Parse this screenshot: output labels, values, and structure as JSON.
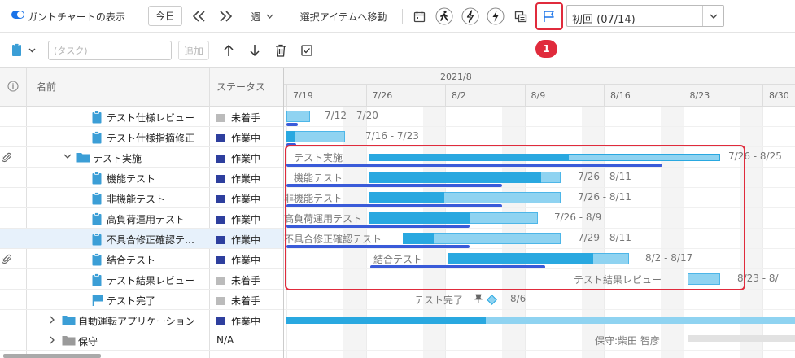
{
  "toolbar": {
    "gantt_toggle_label": "ガントチャートの表示",
    "today_label": "今日",
    "scale_label": "週",
    "move_to_selected_label": "選択アイテムへ移動",
    "milestone_select_value": "初回 (07/14)",
    "callout_number": "1"
  },
  "toolbar2": {
    "task_placeholder": "(タスク)",
    "add_label": "追加"
  },
  "grid": {
    "columns": {
      "name": "名前",
      "status": "ステータス"
    },
    "rows": [
      {
        "name": "テスト仕様レビュー",
        "status": "未着手",
        "status_color": "#bbbbbb",
        "icon": "clipboard-icon"
      },
      {
        "name": "テスト仕様指摘修正",
        "status": "作業中",
        "status_color": "#2e3f9e",
        "icon": "clipboard-icon"
      },
      {
        "name": "テスト実施",
        "status": "作業中",
        "status_color": "#2e3f9e",
        "icon": "folder-icon"
      },
      {
        "name": "機能テスト",
        "status": "作業中",
        "status_color": "#2e3f9e",
        "icon": "clipboard-icon"
      },
      {
        "name": "非機能テスト",
        "status": "作業中",
        "status_color": "#2e3f9e",
        "icon": "clipboard-icon"
      },
      {
        "name": "高負荷運用テスト",
        "status": "作業中",
        "status_color": "#2e3f9e",
        "icon": "clipboard-icon"
      },
      {
        "name": "不具合修正確認テ…",
        "status": "作業中",
        "status_color": "#2e3f9e",
        "icon": "clipboard-icon"
      },
      {
        "name": "結合テスト",
        "status": "作業中",
        "status_color": "#2e3f9e",
        "icon": "clipboard-icon"
      },
      {
        "name": "テスト結果レビュー",
        "status": "未着手",
        "status_color": "#bbbbbb",
        "icon": "clipboard-icon"
      },
      {
        "name": "テスト完了",
        "status": "未着手",
        "status_color": "#bbbbbb",
        "icon": "flag-icon"
      },
      {
        "name": "自動運転アプリケーション",
        "status": "作業中",
        "status_color": "#2e3f9e",
        "icon": "folder-icon"
      },
      {
        "name": "保守",
        "status": "N/A",
        "status_color": "",
        "icon": "folder-icon"
      }
    ]
  },
  "gantt": {
    "month": "2021/8",
    "weeks": [
      "7/19",
      "7/26",
      "8/2",
      "8/9",
      "8/16",
      "8/23",
      "8/30"
    ],
    "items": [
      {
        "label": "",
        "dates": "7/12 - 7/20"
      },
      {
        "label": "",
        "dates": "7/16 - 7/23"
      },
      {
        "label": "テスト実施",
        "dates": "7/26 - 8/25"
      },
      {
        "label": "機能テスト",
        "dates": "7/26 - 8/11"
      },
      {
        "label": "非機能テスト",
        "dates": "7/26 - 8/11"
      },
      {
        "label": "高負荷運用テスト",
        "dates": "7/26 - 8/9"
      },
      {
        "label": "不具合修正確認テスト",
        "dates": "7/29 - 8/11"
      },
      {
        "label": "結合テスト",
        "dates": "8/2 - 8/17"
      },
      {
        "label": "テスト結果レビュー",
        "dates": "8/23 - 8/"
      },
      {
        "label": "テスト完了",
        "dates": "8/6"
      },
      {
        "label": "",
        "dates": ""
      },
      {
        "label": "保守:柴田 智彦",
        "dates": ""
      }
    ]
  },
  "colors": {
    "accent": "#1a73e8",
    "highlight": "#e02b3c",
    "bar_dark": "#29a8e0",
    "bar_light": "#8fd3f1",
    "critical_path": "#3a5bd9"
  }
}
